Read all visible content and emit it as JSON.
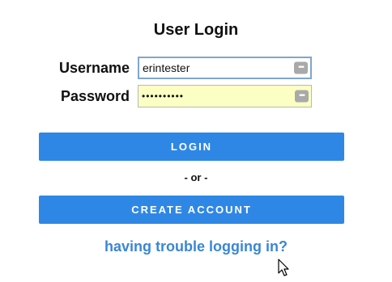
{
  "form": {
    "title": "User Login",
    "username_label": "Username",
    "username_value": "erintester",
    "password_label": "Password",
    "password_value": "••••••••••",
    "login_button": "LOGIN",
    "or_text": "- or -",
    "create_account_button": "CREATE ACCOUNT",
    "trouble_link": "having trouble logging in?"
  },
  "icons": {
    "field_key": "password-manager-key-icon",
    "pointer": "mouse-pointer-icon"
  },
  "colors": {
    "button": "#2f87e5",
    "link": "#3a86d6",
    "autofill": "#fbffc4",
    "focus_border": "#7fa6cf"
  }
}
